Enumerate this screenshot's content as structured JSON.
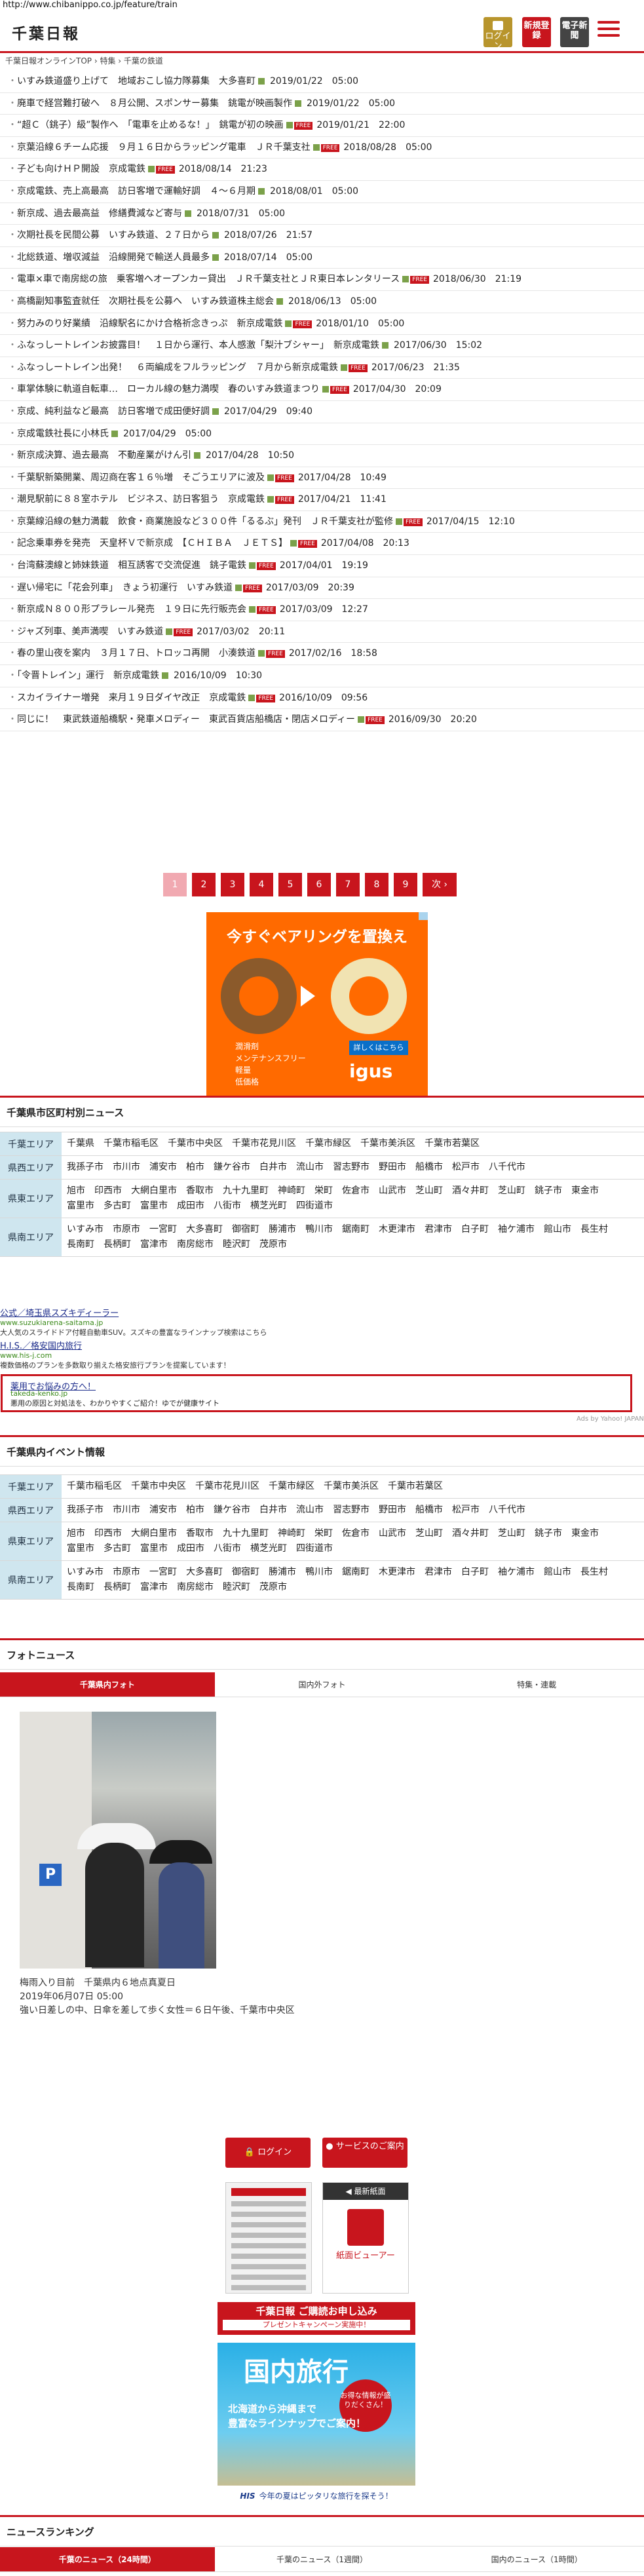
{
  "browser": {
    "url": "http://www.chibanippo.co.jp/feature/train"
  },
  "header": {
    "logo": "千葉日報",
    "login": "ログイン",
    "register": "新規登録",
    "epaper": "電子新聞"
  },
  "breadcrumb": "千葉日報オンラインTOP › 特集 › 千葉の鉄道",
  "news": [
    {
      "title": "いすみ鉄道盛り上げて　地域おこし協力隊募集　大多喜町",
      "date": "2019/01/22　05:00",
      "free": false
    },
    {
      "title": "廃車で経営難打破へ　８月公開、スポンサー募集　銚電が映画製作",
      "date": "2019/01/22　05:00",
      "free": false
    },
    {
      "title": "“超Ｃ（銚子）級”製作へ　「電車を止めるな！」　銚電が初の映画",
      "date": "2019/01/21　22:00",
      "free": true
    },
    {
      "title": "京葉沿線６チーム応援　９月１６日からラッピング電車　ＪＲ千葉支社",
      "date": "2018/08/28　05:00",
      "free": true
    },
    {
      "title": "子ども向けＨＰ開設　京成電鉄",
      "date": "2018/08/14　21:23",
      "free": true
    },
    {
      "title": "京成電鉄、売上高最高　訪日客増で運輸好調　４～６月期",
      "date": "2018/08/01　05:00",
      "free": false
    },
    {
      "title": "新京成、過去最高益　修繕費減など寄与",
      "date": "2018/07/31　05:00",
      "free": false
    },
    {
      "title": "次期社長を民間公募　いすみ鉄道、２７日から",
      "date": "2018/07/26　21:57",
      "free": false
    },
    {
      "title": "北総鉄道、増収減益　沿線開発で輸送人員最多",
      "date": "2018/07/14　05:00",
      "free": false
    },
    {
      "title": "電車×車で南房総の旅　乗客増へオープンカー貸出　ＪＲ千葉支社とＪＲ東日本レンタリース",
      "date": "2018/06/30　21:19",
      "free": true
    },
    {
      "title": "高橋副知事監査就任　次期社長を公募へ　いすみ鉄道株主総会",
      "date": "2018/06/13　05:00",
      "free": false
    },
    {
      "title": "努力みのり好業績　沿線駅名にかけ合格祈念きっぷ　新京成電鉄",
      "date": "2018/01/10　05:00",
      "free": true
    },
    {
      "title": "ふなっしートレインお披露目！　１日から運行、本人感激「梨汁ブシャー」　新京成電鉄",
      "date": "2017/06/30　15:02",
      "free": false
    },
    {
      "title": "ふなっしートレイン出発！　６両編成をフルラッピング　７月から新京成電鉄",
      "date": "2017/06/23　21:35",
      "free": true
    },
    {
      "title": "車掌体験に軌道自転車…　ローカル線の魅力満喫　春のいすみ鉄道まつり",
      "date": "2017/04/30　20:09",
      "free": true
    },
    {
      "title": "京成、純利益など最高　訪日客増で成田便好調",
      "date": "2017/04/29　09:40",
      "free": false
    },
    {
      "title": "京成電鉄社長に小林氏",
      "date": "2017/04/29　05:00",
      "free": false
    },
    {
      "title": "新京成決算、過去最高　不動産業がけん引",
      "date": "2017/04/28　10:50",
      "free": false
    },
    {
      "title": "千葉駅新築開業、周辺商在客１６％増　そごうエリアに波及",
      "date": "2017/04/28　10:49",
      "free": true
    },
    {
      "title": "潮見駅前に８８室ホテル　ビジネス、訪日客狙う　京成電鉄",
      "date": "2017/04/21　11:41",
      "free": true
    },
    {
      "title": "京葉線沿線の魅力満載　飲食・商業施設など３００件「るるぶ」発刊　ＪＲ千葉支社が監修",
      "date": "2017/04/15　12:10",
      "free": true
    },
    {
      "title": "記念乗車券を発売　天皇杯Ｖで新京成　【ＣＨＩＢＡ　ＪＥＴＳ】",
      "date": "2017/04/08　20:13",
      "free": true
    },
    {
      "title": "台湾蘇澳線と姉妹鉄道　相互誘客で交流促進　銚子電鉄",
      "date": "2017/04/01　19:19",
      "free": true
    },
    {
      "title": "遅い帰宅に「花会列車」　きょう初運行　いすみ鉄道",
      "date": "2017/03/09　20:39",
      "free": true
    },
    {
      "title": "新京成Ｎ８００形プラレール発売　１９日に先行販売会",
      "date": "2017/03/09　12:27",
      "free": true
    },
    {
      "title": "ジャズ列車、美声満喫　いすみ鉄道",
      "date": "2017/03/02　20:11",
      "free": true
    },
    {
      "title": "春の里山夜を案内　３月１７日、トロッコ再開　小湊鉄道",
      "date": "2017/02/16　18:58",
      "free": true
    },
    {
      "title": "「令晋トレイン」運行　新京成電鉄",
      "date": "2016/10/09　10:30",
      "free": false
    },
    {
      "title": "スカイライナー増発　来月１９日ダイヤ改正　京成電鉄",
      "date": "2016/10/09　09:56",
      "free": true
    },
    {
      "title": "同じに！　東武鉄道船橋駅・発車メロディー　東武百貨店船橋店・閉店メロディー",
      "date": "2016/09/30　20:20",
      "free": true
    }
  ],
  "free_label": "FREE",
  "pager": {
    "pages": [
      "1",
      "2",
      "3",
      "4",
      "5",
      "6",
      "7",
      "8",
      "9"
    ],
    "current": "1",
    "next": "次 ›"
  },
  "ad1": {
    "headline": "今すぐベアリングを置換え",
    "bullets": [
      "潤滑剤",
      "メンテナンスフリー",
      "軽量",
      "低価格"
    ],
    "cta": "詳しくはこちら",
    "brand": "igus"
  },
  "areas_news": {
    "heading": "千葉県市区町村別ニュース",
    "rows": [
      {
        "label": "千葉エリア",
        "items": [
          "千葉県",
          "千葉市稲毛区",
          "千葉市中央区",
          "千葉市花見川区",
          "千葉市緑区",
          "千葉市美浜区",
          "千葉市若葉区"
        ]
      },
      {
        "label": "県西エリア",
        "items": [
          "我孫子市",
          "市川市",
          "浦安市",
          "柏市",
          "鎌ケ谷市",
          "白井市",
          "流山市",
          "習志野市",
          "野田市",
          "船橋市",
          "松戸市",
          "八千代市"
        ]
      },
      {
        "label": "県東エリア",
        "items": [
          "旭市",
          "印西市",
          "大網白里市",
          "香取市",
          "九十九里町",
          "神崎町",
          "栄町",
          "佐倉市",
          "山武市",
          "芝山町",
          "酒々井町",
          "芝山町",
          "銚子市",
          "東金市",
          "富里市",
          "多古町",
          "富里市",
          "成田市",
          "八街市",
          "横芝光町",
          "四街道市"
        ]
      },
      {
        "label": "県南エリア",
        "items": [
          "いすみ市",
          "市原市",
          "一宮町",
          "大多喜町",
          "御宿町",
          "勝浦市",
          "鴨川市",
          "鋸南町",
          "木更津市",
          "君津市",
          "白子町",
          "袖ケ浦市",
          "館山市",
          "長生村",
          "長南町",
          "長柄町",
          "富津市",
          "南房総市",
          "睦沢町",
          "茂原市"
        ]
      }
    ]
  },
  "text_ads": [
    {
      "title": "公式／埼玉県スズキディーラー",
      "url": "www.suzukiarena-saitama.jp",
      "desc": "大人気のスライドドア付軽自動車SUV。スズキの豊富なラインナップ検索はこちら"
    },
    {
      "title": "H.I.S.／格安国内旅行",
      "url": "www.his-j.com",
      "desc": "複数価格のプランを多数取り揃えた格安旅行プランを提案しています！"
    },
    {
      "title": "薬用でお悩みの方へ！",
      "url": "takeda-kenko.jp",
      "desc": "悪用の原因と対処法を、わかりやすくご紹介！ゆでが健康サイト"
    }
  ],
  "ads_by": "Ads by Yahoo! JAPAN",
  "areas_event": {
    "heading": "千葉県内イベント情報",
    "rows": [
      {
        "label": "千葉エリア",
        "items": [
          "千葉市稲毛区",
          "千葉市中央区",
          "千葉市花見川区",
          "千葉市緑区",
          "千葉市美浜区",
          "千葉市若葉区"
        ]
      },
      {
        "label": "県西エリア",
        "items": [
          "我孫子市",
          "市川市",
          "浦安市",
          "柏市",
          "鎌ケ谷市",
          "白井市",
          "流山市",
          "習志野市",
          "野田市",
          "船橋市",
          "松戸市",
          "八千代市"
        ]
      },
      {
        "label": "県東エリア",
        "items": [
          "旭市",
          "印西市",
          "大網白里市",
          "香取市",
          "九十九里町",
          "神崎町",
          "栄町",
          "佐倉市",
          "山武市",
          "芝山町",
          "酒々井町",
          "芝山町",
          "銚子市",
          "東金市",
          "富里市",
          "多古町",
          "富里市",
          "成田市",
          "八街市",
          "横芝光町",
          "四街道市"
        ]
      },
      {
        "label": "県南エリア",
        "items": [
          "いすみ市",
          "市原市",
          "一宮町",
          "大多喜町",
          "御宿町",
          "勝浦市",
          "鴨川市",
          "鋸南町",
          "木更津市",
          "君津市",
          "白子町",
          "袖ケ浦市",
          "館山市",
          "長生村",
          "長南町",
          "長柄町",
          "富津市",
          "南房総市",
          "睦沢町",
          "茂原市"
        ]
      }
    ]
  },
  "photo_news": {
    "heading": "フォトニュース",
    "tabs": [
      "千葉県内フォト",
      "国内外フォト",
      "特集・連載"
    ],
    "active_tab": 0,
    "caption_title": "梅雨入り目前　千葉県内６地点真夏日",
    "caption_date": "2019年06月07日 05:00",
    "caption_text": "強い日差しの中、日傘を差して歩く女性＝６日午後、千葉市中央区"
  },
  "side": {
    "login": "ログイン",
    "service": "サービスのご案内",
    "latest": "◀ 最新紙面",
    "viewer": "紙面ビューアー",
    "campaign_title": "千葉日報 ご購読お申し込み",
    "campaign_sub": "プレゼントキャンペーン実施中！",
    "travel_title": "国内旅行",
    "travel_badge": "お得な情報が盛りだくさん！",
    "travel_text1": "北海道から沖縄まで",
    "travel_text2": "豊富なラインナップでご案内！",
    "travel_footer_brand": "HIS",
    "travel_footer": "今年の夏はピッタリな旅行を探そう！"
  },
  "ranking": {
    "heading": "ニュースランキング",
    "tabs": [
      "千葉のニュース（24時間）",
      "千葉のニュース（1週間）",
      "国内のニュース（1時間）"
    ],
    "active_tab": 0
  }
}
